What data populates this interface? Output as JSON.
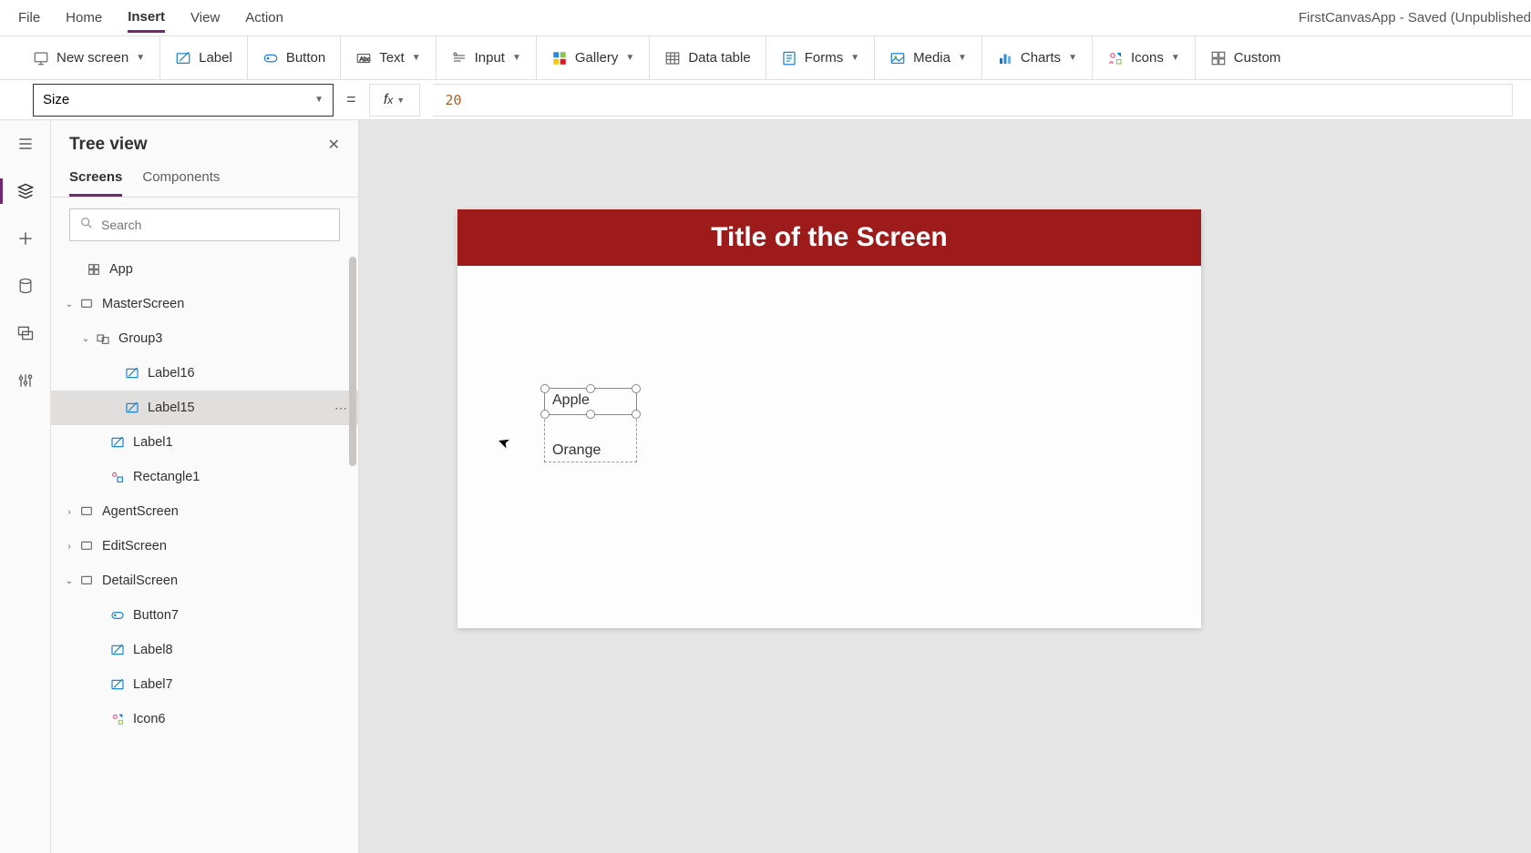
{
  "window_title": "FirstCanvasApp - Saved (Unpublished",
  "menu": {
    "file": "File",
    "home": "Home",
    "insert": "Insert",
    "view": "View",
    "action": "Action",
    "active": "Insert"
  },
  "ribbon": {
    "new_screen": "New screen",
    "label": "Label",
    "button": "Button",
    "text": "Text",
    "input": "Input",
    "gallery": "Gallery",
    "data_table": "Data table",
    "forms": "Forms",
    "media": "Media",
    "charts": "Charts",
    "icons": "Icons",
    "custom": "Custom"
  },
  "property_dropdown_value": "Size",
  "formula_value": "20",
  "tree": {
    "title": "Tree view",
    "tab_screens": "Screens",
    "tab_components": "Components",
    "search_placeholder": "Search",
    "app": "App",
    "items": [
      {
        "name": "MasterScreen",
        "depth": 1,
        "expanded": true,
        "type": "screen"
      },
      {
        "name": "Group3",
        "depth": 2,
        "expanded": true,
        "type": "group"
      },
      {
        "name": "Label16",
        "depth": 3,
        "type": "label"
      },
      {
        "name": "Label15",
        "depth": 3,
        "type": "label",
        "selected": true
      },
      {
        "name": "Label1",
        "depth": "3b",
        "type": "label"
      },
      {
        "name": "Rectangle1",
        "depth": "3b",
        "type": "rect"
      },
      {
        "name": "AgentScreen",
        "depth": 1,
        "expanded": false,
        "type": "screen"
      },
      {
        "name": "EditScreen",
        "depth": 1,
        "expanded": false,
        "type": "screen"
      },
      {
        "name": "DetailScreen",
        "depth": 1,
        "expanded": true,
        "type": "screen"
      },
      {
        "name": "Button7",
        "depth": "3b",
        "type": "button"
      },
      {
        "name": "Label8",
        "depth": "3b",
        "type": "label"
      },
      {
        "name": "Label7",
        "depth": "3b",
        "type": "label"
      },
      {
        "name": "Icon6",
        "depth": "3b",
        "type": "icon"
      }
    ]
  },
  "canvas": {
    "title": "Title of the Screen",
    "label_apple": "Apple",
    "label_orange": "Orange"
  }
}
